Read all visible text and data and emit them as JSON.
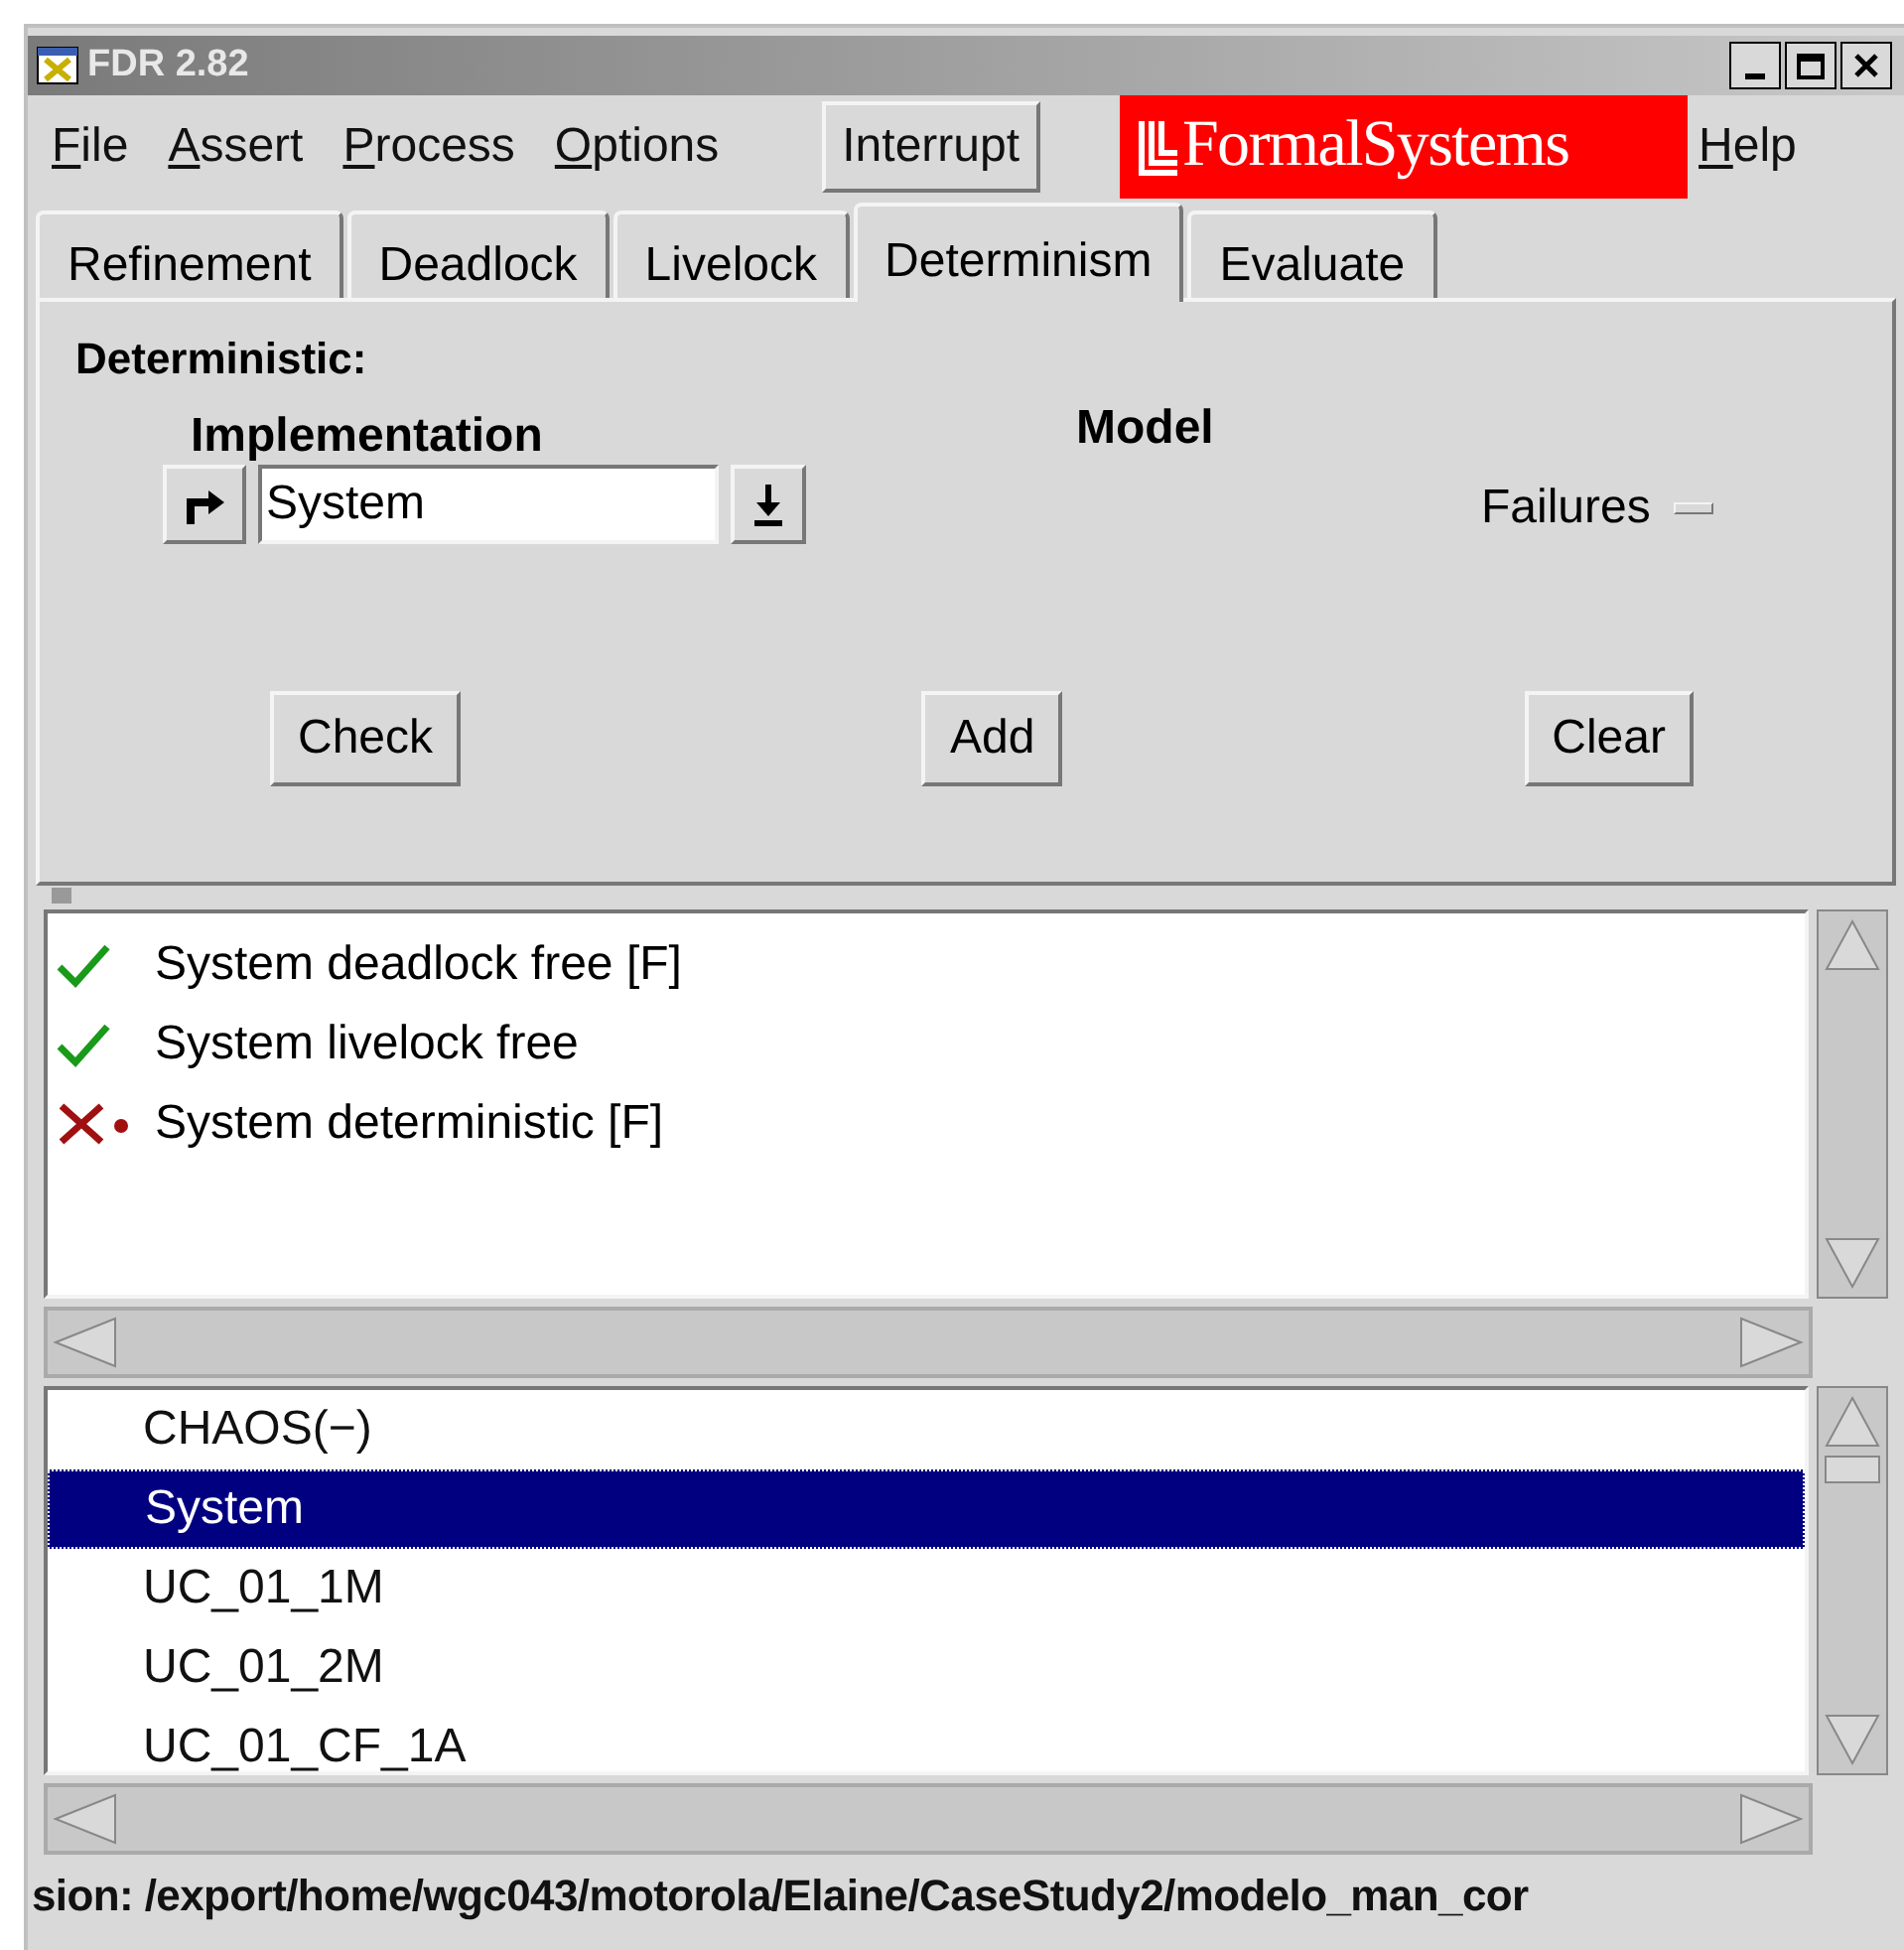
{
  "window": {
    "title": "FDR 2.82"
  },
  "menu": [
    {
      "label": "File"
    },
    {
      "label": "Assert"
    },
    {
      "label": "Process"
    },
    {
      "label": "Options"
    }
  ],
  "interrupt_button": "Interrupt",
  "logo": "FormalSystems",
  "help_menu": "Help",
  "tabs": [
    {
      "label": "Refinement",
      "selected": false
    },
    {
      "label": "Deadlock",
      "selected": false
    },
    {
      "label": "Livelock",
      "selected": false
    },
    {
      "label": "Determinism",
      "selected": true
    },
    {
      "label": "Evaluate",
      "selected": false
    }
  ],
  "panel": {
    "heading": "Deterministic:",
    "implementation_label": "Implementation",
    "implementation_value": "System",
    "model_label": "Model",
    "model_option": {
      "label": "Failures",
      "on": false
    },
    "buttons": [
      "Check",
      "Add",
      "Clear"
    ]
  },
  "results": [
    {
      "text": "System deadlock free [F]",
      "kind": "pass"
    },
    {
      "text": "System livelock free",
      "kind": "pass"
    },
    {
      "text": "System deterministic [F]",
      "kind": "fail"
    }
  ],
  "processes": [
    {
      "name": "CHAOS(−)",
      "selected": false
    },
    {
      "name": "System",
      "selected": true
    },
    {
      "name": "UC_01_1M",
      "selected": false
    },
    {
      "name": "UC_01_2M",
      "selected": false
    },
    {
      "name": "UC_01_CF_1A",
      "selected": false
    }
  ],
  "status_bar": "sion: /export/home/wgc043/motorola/Elaine/CaseStudy2/modelo_man_cor"
}
